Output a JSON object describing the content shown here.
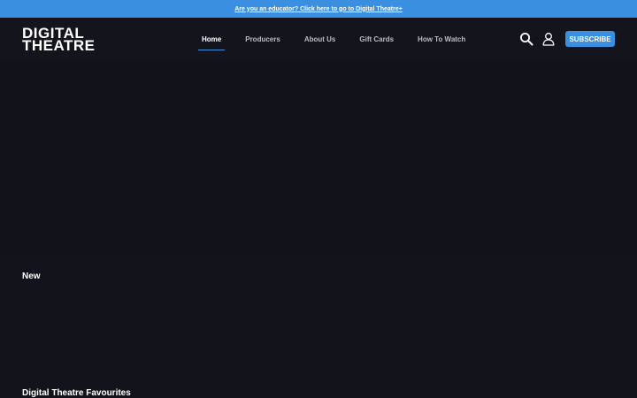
{
  "banner": {
    "text": "Are you an educator? Click here to go to Digital Theatre+"
  },
  "header": {
    "logo": {
      "line1": "DIGITAL",
      "line2": "THEATRE"
    },
    "nav": [
      {
        "label": "Home",
        "active": true
      },
      {
        "label": "Producers",
        "active": false
      },
      {
        "label": "About Us",
        "active": false
      },
      {
        "label": "Gift Cards",
        "active": false
      },
      {
        "label": "How To Watch",
        "active": false
      }
    ],
    "icons": {
      "search": "search-icon",
      "account": "user-icon"
    },
    "subscribe_label": "SUBSCRIBE"
  },
  "sections": {
    "new_title": "New",
    "favourites_title": "Digital Theatre Favourites"
  },
  "colors": {
    "accent": "#3a8fe0",
    "background": "#13131b",
    "nav_inactive": "#b9bcc6",
    "text": "#ffffff"
  }
}
